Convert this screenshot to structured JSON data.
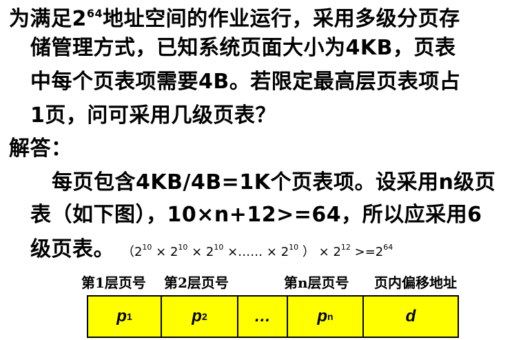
{
  "question": {
    "line1_a": "为满足2",
    "line1_sup": "64",
    "line1_b": "地址空间的作业运行，采用多级分页存",
    "line2": "储管理方式，已知系统页面大小为4KB，页表",
    "line3": "中每个页表项需要4B。若限定最高层页表项占",
    "line4": "1页，问可采用几级页表？"
  },
  "answer": {
    "heading": "解答：",
    "line1": "每页包含4KB/4B=1K个页表项。设采用n级页",
    "line2": "表（如下图），10×n+12>=64，所以应采用6",
    "line3": "级页表。",
    "formula": {
      "open": "（2",
      "exp10": "10",
      "times": " × ",
      "base": "2",
      "dots": " ×…… × ",
      "close": " ）",
      "exp12": "12",
      "ge": " >=2",
      "exp64": "64"
    }
  },
  "diagram": {
    "labels": [
      "第1层页号",
      "第2层页号",
      "第n层页号",
      "页内偏移地址"
    ],
    "cells": [
      {
        "main": "p",
        "sub": "1"
      },
      {
        "main": "p",
        "sub": "2"
      },
      {
        "main": "…",
        "sub": ""
      },
      {
        "main": "p",
        "sub": "n"
      },
      {
        "main": "d",
        "sub": ""
      }
    ],
    "fill_color": "#ffff00"
  }
}
